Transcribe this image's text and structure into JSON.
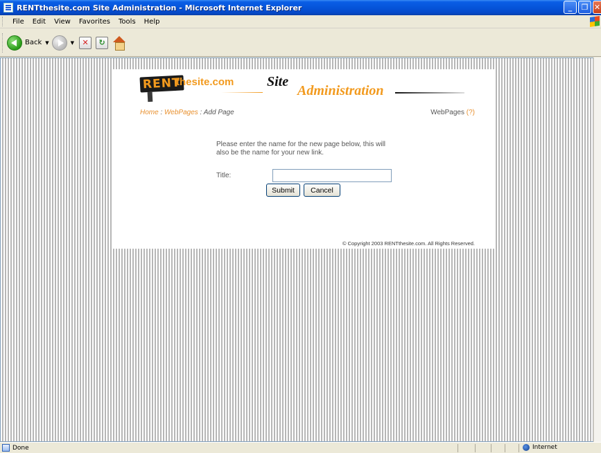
{
  "window": {
    "title": "RENTthesite.com Site Administration - Microsoft Internet Explorer",
    "buttons": [
      "_",
      "❐",
      "✕"
    ]
  },
  "menu": [
    "File",
    "Edit",
    "View",
    "Favorites",
    "Tools",
    "Help"
  ],
  "toolbar": {
    "back_label": "Back"
  },
  "header": {
    "logo_rent": "RENT",
    "logo_site": "thesite.com",
    "title_site": "Site",
    "title_admin": "Administration"
  },
  "breadcrumb": {
    "home": "Home",
    "sep1": " : ",
    "webpages": "WebPages",
    "sep2": " : ",
    "current": "Add Page"
  },
  "section": {
    "label": "WebPages",
    "help": "(?)"
  },
  "form": {
    "instructions": "Please enter the name for the new page below, this will also be the name for your new link.",
    "title_label": "Title:",
    "title_value": "",
    "submit_label": "Submit",
    "cancel_label": "Cancel"
  },
  "footer": {
    "copyright": "© Copyright 2003 RENTthesite.com. All Rights Reserved."
  },
  "status": {
    "text": "Done",
    "zone": "Internet"
  }
}
